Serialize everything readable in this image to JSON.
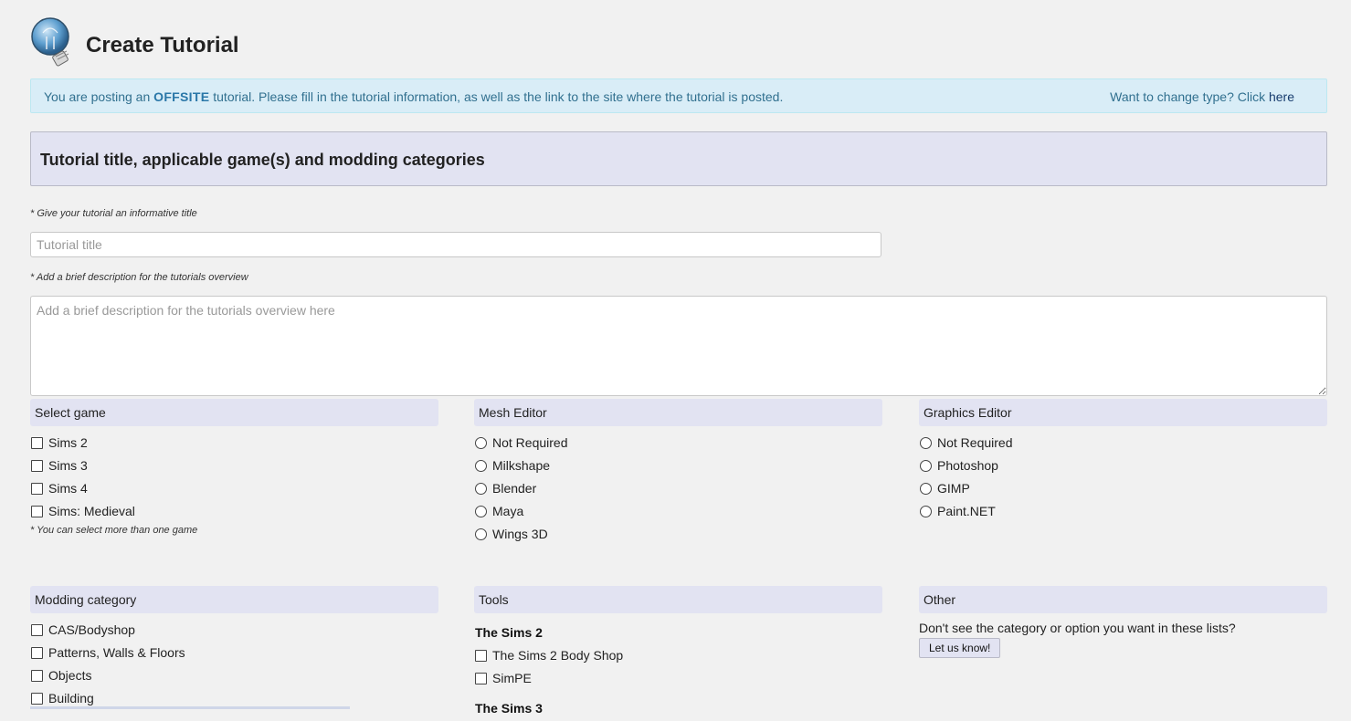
{
  "header": {
    "title": "Create Tutorial",
    "icon": "lightbulb-icon"
  },
  "info": {
    "prefix": "You are posting an ",
    "type": "OFFSITE",
    "suffix": " tutorial. Please fill in the tutorial information, as well as the link to the site where the tutorial is posted.",
    "change_prefix": "Want to change type? Click ",
    "change_link": "here"
  },
  "section": {
    "title": "Tutorial title, applicable game(s) and modding categories"
  },
  "form": {
    "title_hint": "* Give your tutorial an informative title",
    "title_placeholder": "Tutorial title",
    "desc_hint": "* Add a brief description for the tutorials overview",
    "desc_placeholder": "Add a brief description for the tutorials overview here"
  },
  "select_game": {
    "heading": "Select game",
    "options": [
      "Sims 2",
      "Sims 3",
      "Sims 4",
      "Sims: Medieval"
    ],
    "note": "* You can select more than one game"
  },
  "mesh_editor": {
    "heading": "Mesh Editor",
    "options": [
      "Not Required",
      "Milkshape",
      "Blender",
      "Maya",
      "Wings 3D"
    ]
  },
  "graphics_editor": {
    "heading": "Graphics Editor",
    "options": [
      "Not Required",
      "Photoshop",
      "GIMP",
      "Paint.NET"
    ]
  },
  "modding_category": {
    "heading": "Modding category",
    "options": [
      "CAS/Bodyshop",
      "Patterns, Walls & Floors",
      "Objects",
      "Building"
    ]
  },
  "tools": {
    "heading": "Tools",
    "group1": "The Sims 2",
    "group1_options": [
      "The Sims 2 Body Shop",
      "SimPE"
    ],
    "group2": "The Sims 3"
  },
  "other": {
    "heading": "Other",
    "text": "Don't see the category or option you want in these lists?",
    "button": "Let us know!"
  },
  "colors": {
    "info_bg": "#d9edf7",
    "info_text": "#31708f",
    "section_bg": "#e2e3f2",
    "page_bg": "#f1f1f1"
  }
}
